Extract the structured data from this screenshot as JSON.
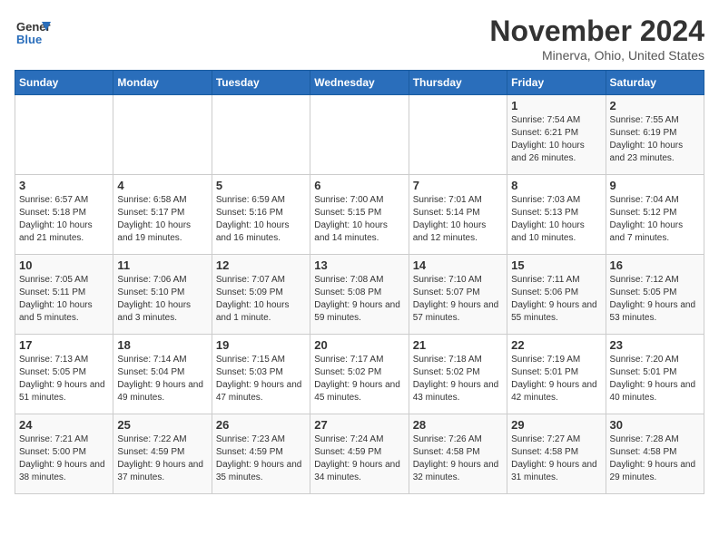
{
  "logo": {
    "general": "General",
    "blue": "Blue"
  },
  "title": {
    "month_year": "November 2024",
    "location": "Minerva, Ohio, United States"
  },
  "days_of_week": [
    "Sunday",
    "Monday",
    "Tuesday",
    "Wednesday",
    "Thursday",
    "Friday",
    "Saturday"
  ],
  "weeks": [
    [
      {
        "day": "",
        "info": ""
      },
      {
        "day": "",
        "info": ""
      },
      {
        "day": "",
        "info": ""
      },
      {
        "day": "",
        "info": ""
      },
      {
        "day": "",
        "info": ""
      },
      {
        "day": "1",
        "info": "Sunrise: 7:54 AM\nSunset: 6:21 PM\nDaylight: 10 hours and 26 minutes."
      },
      {
        "day": "2",
        "info": "Sunrise: 7:55 AM\nSunset: 6:19 PM\nDaylight: 10 hours and 23 minutes."
      }
    ],
    [
      {
        "day": "3",
        "info": "Sunrise: 6:57 AM\nSunset: 5:18 PM\nDaylight: 10 hours and 21 minutes."
      },
      {
        "day": "4",
        "info": "Sunrise: 6:58 AM\nSunset: 5:17 PM\nDaylight: 10 hours and 19 minutes."
      },
      {
        "day": "5",
        "info": "Sunrise: 6:59 AM\nSunset: 5:16 PM\nDaylight: 10 hours and 16 minutes."
      },
      {
        "day": "6",
        "info": "Sunrise: 7:00 AM\nSunset: 5:15 PM\nDaylight: 10 hours and 14 minutes."
      },
      {
        "day": "7",
        "info": "Sunrise: 7:01 AM\nSunset: 5:14 PM\nDaylight: 10 hours and 12 minutes."
      },
      {
        "day": "8",
        "info": "Sunrise: 7:03 AM\nSunset: 5:13 PM\nDaylight: 10 hours and 10 minutes."
      },
      {
        "day": "9",
        "info": "Sunrise: 7:04 AM\nSunset: 5:12 PM\nDaylight: 10 hours and 7 minutes."
      }
    ],
    [
      {
        "day": "10",
        "info": "Sunrise: 7:05 AM\nSunset: 5:11 PM\nDaylight: 10 hours and 5 minutes."
      },
      {
        "day": "11",
        "info": "Sunrise: 7:06 AM\nSunset: 5:10 PM\nDaylight: 10 hours and 3 minutes."
      },
      {
        "day": "12",
        "info": "Sunrise: 7:07 AM\nSunset: 5:09 PM\nDaylight: 10 hours and 1 minute."
      },
      {
        "day": "13",
        "info": "Sunrise: 7:08 AM\nSunset: 5:08 PM\nDaylight: 9 hours and 59 minutes."
      },
      {
        "day": "14",
        "info": "Sunrise: 7:10 AM\nSunset: 5:07 PM\nDaylight: 9 hours and 57 minutes."
      },
      {
        "day": "15",
        "info": "Sunrise: 7:11 AM\nSunset: 5:06 PM\nDaylight: 9 hours and 55 minutes."
      },
      {
        "day": "16",
        "info": "Sunrise: 7:12 AM\nSunset: 5:05 PM\nDaylight: 9 hours and 53 minutes."
      }
    ],
    [
      {
        "day": "17",
        "info": "Sunrise: 7:13 AM\nSunset: 5:05 PM\nDaylight: 9 hours and 51 minutes."
      },
      {
        "day": "18",
        "info": "Sunrise: 7:14 AM\nSunset: 5:04 PM\nDaylight: 9 hours and 49 minutes."
      },
      {
        "day": "19",
        "info": "Sunrise: 7:15 AM\nSunset: 5:03 PM\nDaylight: 9 hours and 47 minutes."
      },
      {
        "day": "20",
        "info": "Sunrise: 7:17 AM\nSunset: 5:02 PM\nDaylight: 9 hours and 45 minutes."
      },
      {
        "day": "21",
        "info": "Sunrise: 7:18 AM\nSunset: 5:02 PM\nDaylight: 9 hours and 43 minutes."
      },
      {
        "day": "22",
        "info": "Sunrise: 7:19 AM\nSunset: 5:01 PM\nDaylight: 9 hours and 42 minutes."
      },
      {
        "day": "23",
        "info": "Sunrise: 7:20 AM\nSunset: 5:01 PM\nDaylight: 9 hours and 40 minutes."
      }
    ],
    [
      {
        "day": "24",
        "info": "Sunrise: 7:21 AM\nSunset: 5:00 PM\nDaylight: 9 hours and 38 minutes."
      },
      {
        "day": "25",
        "info": "Sunrise: 7:22 AM\nSunset: 4:59 PM\nDaylight: 9 hours and 37 minutes."
      },
      {
        "day": "26",
        "info": "Sunrise: 7:23 AM\nSunset: 4:59 PM\nDaylight: 9 hours and 35 minutes."
      },
      {
        "day": "27",
        "info": "Sunrise: 7:24 AM\nSunset: 4:59 PM\nDaylight: 9 hours and 34 minutes."
      },
      {
        "day": "28",
        "info": "Sunrise: 7:26 AM\nSunset: 4:58 PM\nDaylight: 9 hours and 32 minutes."
      },
      {
        "day": "29",
        "info": "Sunrise: 7:27 AM\nSunset: 4:58 PM\nDaylight: 9 hours and 31 minutes."
      },
      {
        "day": "30",
        "info": "Sunrise: 7:28 AM\nSunset: 4:58 PM\nDaylight: 9 hours and 29 minutes."
      }
    ]
  ]
}
